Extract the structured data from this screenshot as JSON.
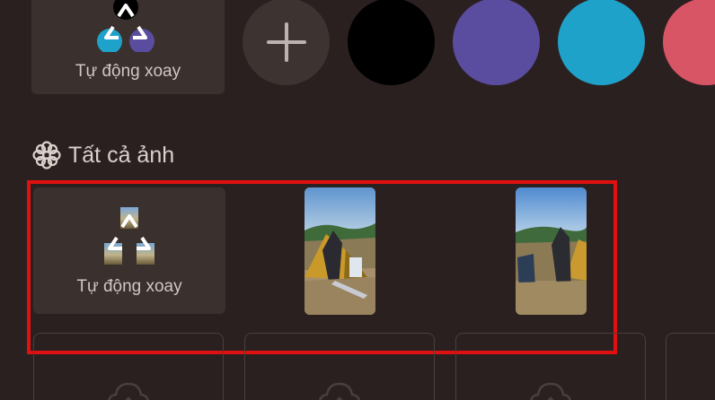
{
  "top_row": {
    "auto_rotate_label": "Tự động xoay",
    "add_icon": "plus-icon",
    "swatches": [
      {
        "name": "black",
        "color": "#000000"
      },
      {
        "name": "purple",
        "color": "#5a4da0"
      },
      {
        "name": "cyan",
        "color": "#1fa2c9"
      },
      {
        "name": "red",
        "color": "#d85566"
      }
    ]
  },
  "section": {
    "icon": "flower-icon",
    "title": "Tất cả ảnh"
  },
  "gallery": {
    "auto_rotate_label": "Tự động xoay",
    "photos": [
      {
        "name": "camping-photo-1",
        "description_icon": "image"
      },
      {
        "name": "camping-photo-2",
        "description_icon": "image"
      }
    ]
  },
  "upload_slots": [
    {
      "icon": "cloud-upload-icon"
    },
    {
      "icon": "cloud-upload-icon"
    },
    {
      "icon": "cloud-upload-icon"
    },
    {
      "icon": "cloud-upload-icon"
    }
  ],
  "colors": {
    "background": "#2b2020",
    "tile": "#3a302d",
    "highlight": "#e01010"
  }
}
